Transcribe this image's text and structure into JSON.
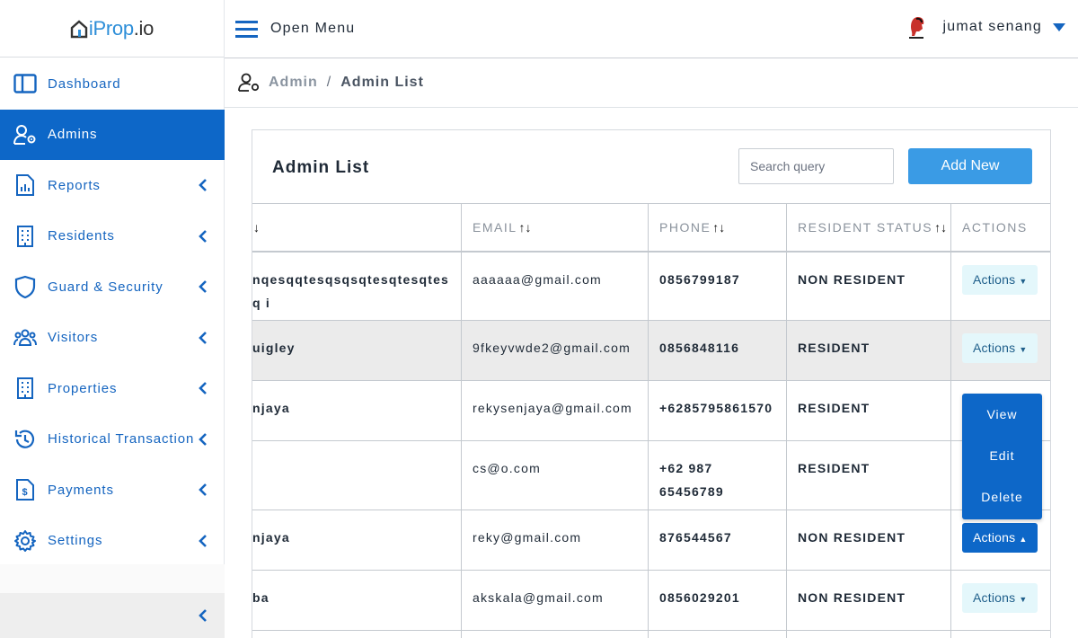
{
  "brand": {
    "logo_main": "iProp",
    "logo_domain": ".io"
  },
  "colors": {
    "primary": "#0d67c8",
    "accent": "#3a9be5",
    "nav_text": "#1565c0",
    "row_highlight": "#ebebeb"
  },
  "topbar": {
    "menu_label": "Open Menu",
    "user_name": "jumat senang"
  },
  "sidebar": {
    "items": [
      {
        "label": "Dashboard",
        "icon": "layout-icon",
        "has_submenu": false,
        "active": false
      },
      {
        "label": "Admins",
        "icon": "user-gear-icon",
        "has_submenu": false,
        "active": true
      },
      {
        "label": "Reports",
        "icon": "report-icon",
        "has_submenu": true,
        "active": false
      },
      {
        "label": "Residents",
        "icon": "building-icon",
        "has_submenu": true,
        "active": false
      },
      {
        "label": "Guard & Security",
        "icon": "shield-icon",
        "has_submenu": true,
        "active": false
      },
      {
        "label": "Visitors",
        "icon": "users-icon",
        "has_submenu": true,
        "active": false
      },
      {
        "label": "Properties",
        "icon": "building-icon",
        "has_submenu": true,
        "active": false
      },
      {
        "label": "Historical Transaction",
        "icon": "history-icon",
        "has_submenu": true,
        "active": false
      },
      {
        "label": "Payments",
        "icon": "invoice-icon",
        "has_submenu": true,
        "active": false
      },
      {
        "label": "Settings",
        "icon": "gear-icon",
        "has_submenu": true,
        "active": false
      }
    ]
  },
  "breadcrumb": {
    "parent": "Admin",
    "separator": "/",
    "current": "Admin List"
  },
  "card": {
    "title": "Admin List",
    "search_placeholder": "Search query",
    "add_label": "Add New"
  },
  "table": {
    "headers": [
      "",
      "EMAIL",
      "PHONE",
      "RESIDENT STATUS",
      "ACTIONS"
    ],
    "rows": [
      {
        "name": "nqesqqtesqsqsqtesqtesqtesq i",
        "email": "aaaaaa@gmail.com",
        "phone": "0856799187",
        "status": "NON RESIDENT",
        "action": "Actions"
      },
      {
        "name": "uigley",
        "email": "9fkeyvwde2@gmail.com",
        "phone": "0856848116",
        "status": "RESIDENT",
        "action": "Actions"
      },
      {
        "name": "njaya",
        "email": "rekysenjaya@gmail.com",
        "phone": "+6285795861570",
        "status": "RESIDENT",
        "action": ""
      },
      {
        "name": "",
        "email": "cs@o.com",
        "phone": "+62 987 65456789",
        "status": "RESIDENT",
        "action": ""
      },
      {
        "name": "njaya",
        "email": "reky@gmail.com",
        "phone": "876544567",
        "status": "NON RESIDENT",
        "action": "Actions"
      },
      {
        "name": "ba",
        "email": "akskala@gmail.com",
        "phone": "0856029201",
        "status": "NON RESIDENT",
        "action": "Actions"
      }
    ]
  },
  "dropdown": {
    "items": [
      "View",
      "Edit",
      "Delete"
    ]
  }
}
